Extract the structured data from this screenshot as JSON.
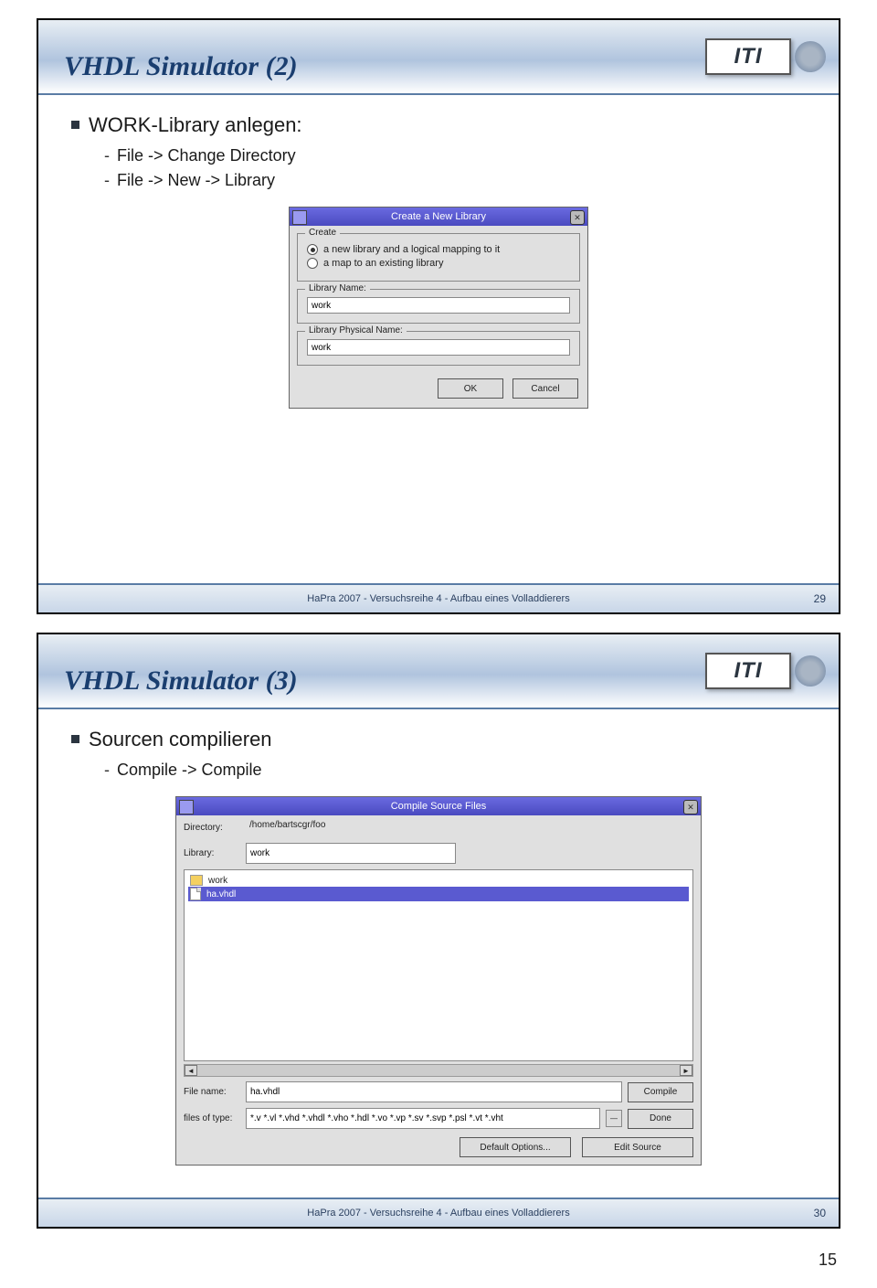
{
  "slide1": {
    "title": "VHDL Simulator (2)",
    "logo": "ITI",
    "bullet": "WORK-Library anlegen:",
    "sub1": "File -> Change Directory",
    "sub2": "File -> New -> Library",
    "dialog": {
      "title": "Create a New Library",
      "group_create": "Create",
      "opt1": "a new library and a logical mapping to it",
      "opt2": "a map to an existing library",
      "libname_label": "Library Name:",
      "libname_value": "work",
      "libphys_label": "Library Physical Name:",
      "libphys_value": "work",
      "ok": "OK",
      "cancel": "Cancel"
    },
    "footer": "HaPra 2007 - Versuchsreihe 4 - Aufbau eines Volladdierers",
    "footer_num": "29"
  },
  "slide2": {
    "title": "VHDL Simulator (3)",
    "logo": "ITI",
    "bullet": "Sourcen compilieren",
    "sub1": "Compile -> Compile",
    "dialog": {
      "title": "Compile Source Files",
      "directory_label": "Directory:",
      "directory_value": "/home/bartscgr/foo",
      "library_label": "Library:",
      "library_value": "work",
      "folder_item": "work",
      "file_item": "ha.vhdl",
      "filename_label": "File name:",
      "filename_value": "ha.vhdl",
      "filetype_label": "files of type:",
      "filetype_value": "*.v *.vl *.vhd *.vhdl *.vho *.hdl *.vo *.vp *.sv *.svp *.psl *.vt *.vht",
      "compile_btn": "Compile",
      "done_btn": "Done",
      "default_opts": "Default Options...",
      "edit_source": "Edit Source"
    },
    "footer": "HaPra 2007 - Versuchsreihe 4 - Aufbau eines Volladdierers",
    "footer_num": "30"
  },
  "outer_pagenum": "15"
}
